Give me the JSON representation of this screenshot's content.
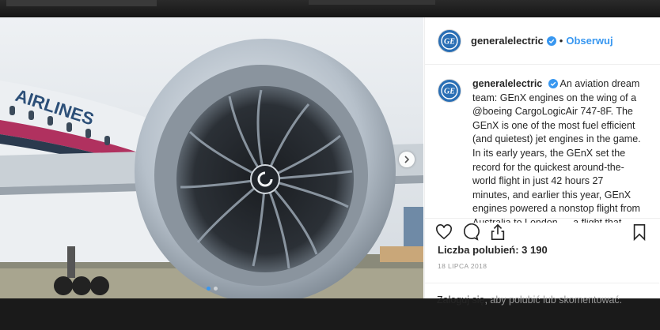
{
  "post": {
    "username": "generalelectric",
    "separator": "•",
    "follow_label": "Obserwuj",
    "caption_username": "generalelectric",
    "caption": "An aviation dream team: GEnX engines on the wing of a @boeing CargoLogicAir 747-8F. The GEnX is one of the most fuel efficient (and quietest) jet engines in the game. In its early years, the GEnX set the record for the quickest around-the-world flight in just 42 hours 27 minutes, and earlier this year, GEnX engines powered a nonstop flight from Australia to London — a flight that",
    "likes_label": "Liczba polubień: 3 190",
    "date": "18 LIPCA 2018",
    "login_link": "Zaloguj się",
    "login_rest": ", aby polubić lub skomentować."
  },
  "media": {
    "fuselage_text": "AIRLINES",
    "slides": 2,
    "active_slide": 1
  },
  "icons": {
    "avatar": "ge-logo-icon",
    "verified": "verified-badge-icon",
    "like": "heart-icon",
    "comment": "comment-icon",
    "share": "share-icon",
    "save": "bookmark-icon",
    "next": "chevron-right-icon"
  },
  "colors": {
    "accent": "#3897f0",
    "ge_blue": "#2a6fb5",
    "text": "#262626",
    "muted": "#999999"
  }
}
